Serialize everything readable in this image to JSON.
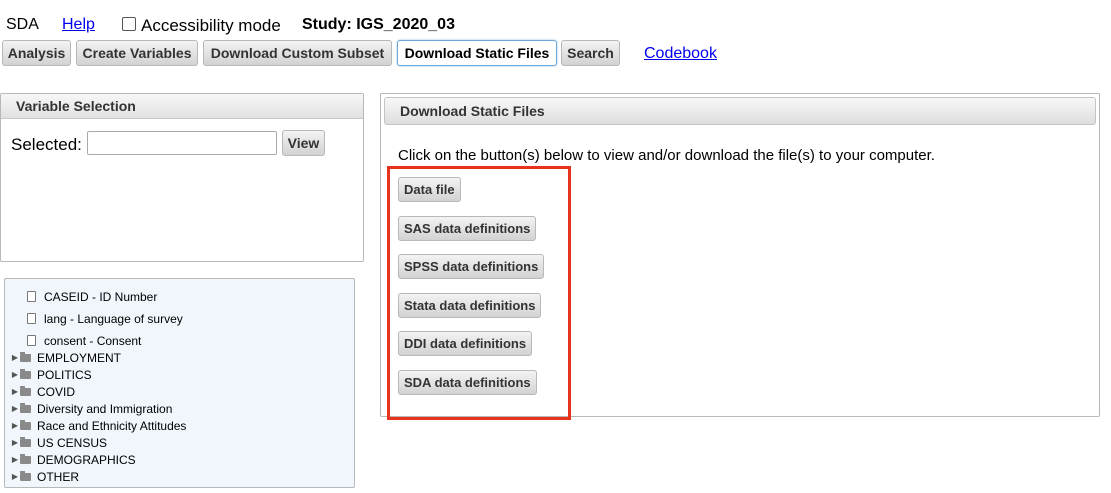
{
  "header": {
    "app_name": "SDA",
    "help_label": "Help",
    "accessibility_label": "Accessibility mode",
    "accessibility_checked": false,
    "study_label": "Study: IGS_2020_03"
  },
  "tabs": [
    {
      "label": "Analysis",
      "active": false
    },
    {
      "label": "Create Variables",
      "active": false
    },
    {
      "label": "Download Custom Subset",
      "active": false
    },
    {
      "label": "Download Static Files",
      "active": true
    },
    {
      "label": "Search",
      "active": false
    }
  ],
  "codebook_label": "Codebook",
  "variable_selection": {
    "title": "Variable Selection",
    "selected_label": "Selected:",
    "selected_value": "",
    "view_label": "View"
  },
  "tree": {
    "variables": [
      {
        "label": "CASEID - ID Number"
      },
      {
        "label": "lang - Language of survey"
      },
      {
        "label": "consent - Consent"
      }
    ],
    "folders": [
      {
        "label": "EMPLOYMENT"
      },
      {
        "label": "POLITICS"
      },
      {
        "label": "COVID"
      },
      {
        "label": "Diversity and Immigration"
      },
      {
        "label": "Race and Ethnicity Attitudes"
      },
      {
        "label": "US CENSUS"
      },
      {
        "label": "DEMOGRAPHICS"
      },
      {
        "label": "OTHER"
      }
    ]
  },
  "download": {
    "title": "Download Static Files",
    "instruction": "Click on the button(s) below to view and/or download the file(s) to your computer.",
    "buttons": [
      {
        "label": "Data file"
      },
      {
        "label": "SAS data definitions"
      },
      {
        "label": "SPSS data definitions"
      },
      {
        "label": "Stata data definitions"
      },
      {
        "label": "DDI data definitions"
      },
      {
        "label": "SDA data definitions"
      }
    ]
  },
  "highlight_color": "#e8321e",
  "link_color": "#0000ee"
}
